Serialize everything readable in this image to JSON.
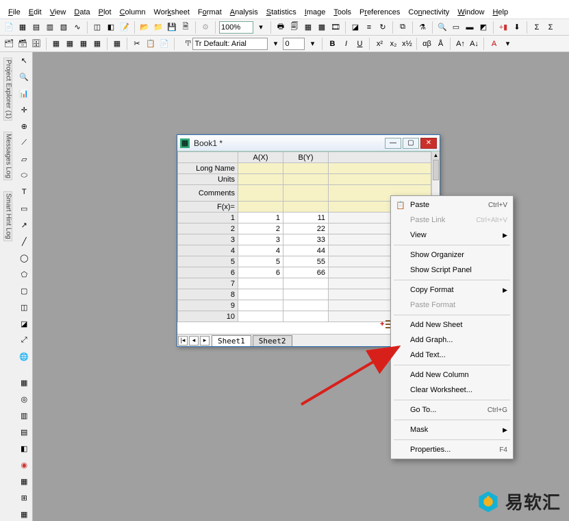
{
  "menus": [
    "File",
    "Edit",
    "View",
    "Data",
    "Plot",
    "Column",
    "Worksheet",
    "Format",
    "Analysis",
    "Statistics",
    "Image",
    "Tools",
    "Preferences",
    "Connectivity",
    "Window",
    "Help"
  ],
  "toolbar": {
    "zoom": "100%",
    "font_label": "Tr Default: Arial",
    "font_size": "0",
    "bold": "B",
    "italic": "I",
    "underline": "U"
  },
  "side_tabs": [
    "Project Explorer (1)",
    "Messages Log",
    "Smart Hint Log"
  ],
  "book": {
    "title": "Book1 *",
    "columns": [
      "A(X)",
      "B(Y)"
    ],
    "label_rows": [
      "Long Name",
      "Units",
      "Comments",
      "F(x)="
    ],
    "rows": [
      {
        "n": "1",
        "a": "1",
        "b": "11"
      },
      {
        "n": "2",
        "a": "2",
        "b": "22"
      },
      {
        "n": "3",
        "a": "3",
        "b": "33"
      },
      {
        "n": "4",
        "a": "4",
        "b": "44"
      },
      {
        "n": "5",
        "a": "5",
        "b": "55"
      },
      {
        "n": "6",
        "a": "6",
        "b": "66"
      },
      {
        "n": "7",
        "a": "",
        "b": ""
      },
      {
        "n": "8",
        "a": "",
        "b": ""
      },
      {
        "n": "9",
        "a": "",
        "b": ""
      },
      {
        "n": "10",
        "a": "",
        "b": ""
      }
    ],
    "tabs": [
      "Sheet1",
      "Sheet2"
    ]
  },
  "context_menu": {
    "paste": "Paste",
    "paste_kb": "Ctrl+V",
    "paste_link": "Paste Link",
    "paste_link_kb": "Ctrl+Alt+V",
    "view": "View",
    "show_org": "Show Organizer",
    "show_script": "Show Script Panel",
    "copy_fmt": "Copy Format",
    "paste_fmt": "Paste Format",
    "add_sheet": "Add New Sheet",
    "add_graph": "Add Graph...",
    "add_text": "Add Text...",
    "add_col": "Add New Column",
    "clear_ws": "Clear Worksheet...",
    "goto": "Go To...",
    "goto_kb": "Ctrl+G",
    "mask": "Mask",
    "props": "Properties...",
    "props_kb": "F4"
  },
  "watermark": "易软汇"
}
